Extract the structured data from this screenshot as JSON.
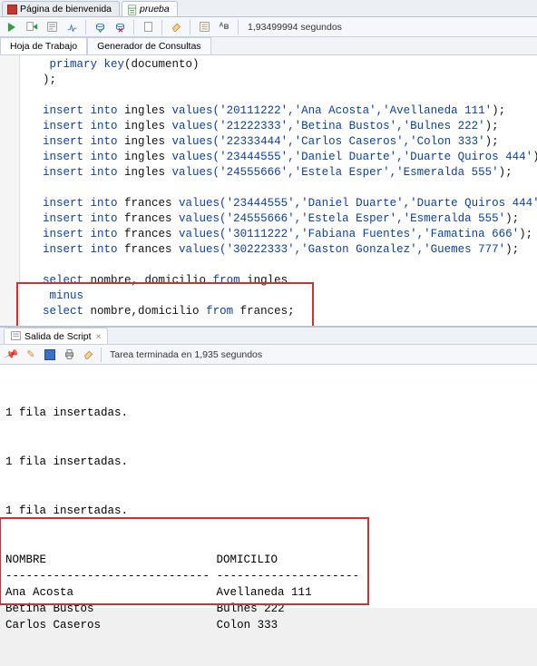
{
  "tabs": {
    "welcome": "Página de bienvenida",
    "file": "prueba"
  },
  "timer": "1,93499994 segundos",
  "subtabs": {
    "worksheet": "Hoja de Trabajo",
    "querybuilder": "Generador de Consultas"
  },
  "code": {
    "l1_a": "primary key",
    "l1_b": "(documento)",
    "l2": ");",
    "ins": "insert into",
    "vals": " values(",
    "t_ing": " ingles",
    "t_fra": " frances",
    "r1": "'20111222','Ana Acosta','Avellaneda 111'",
    "r2": "'21222333','Betina Bustos','Bulnes 222'",
    "r3": "'22333444','Carlos Caseros','Colon 333'",
    "r4": "'23444555','Daniel Duarte','Duarte Quiros 444'",
    "r5": "'24555666','Estela Esper','Esmeralda 555'",
    "f1": "'23444555','Daniel Duarte','Duarte Quiros 444'",
    "f2": "'24555666','Estela Esper','Esmeralda 555'",
    "f3": "'30111222','Fabiana Fuentes','Famatina 666'",
    "f4": "'30222333','Gaston Gonzalez','Guemes 777'",
    "end": ");",
    "sel": "select",
    "from": "from",
    "sel1_cols": " nombre, domicilio ",
    "sel1_tbl": " ingles",
    "minus": "minus",
    "sel2_cols": " nombre,domicilio ",
    "sel2_tbl": " frances"
  },
  "output": {
    "tab_title": "Salida de Script",
    "status": "Tarea terminada en 1,935 segundos",
    "row_inserted": "1 fila insertadas.",
    "hdr_nombre": "NOMBRE",
    "hdr_domicilio": "DOMICILIO",
    "dashes1": "------------------------------",
    "dashes2": "---------------------",
    "rows": [
      {
        "n": "Ana Acosta",
        "d": "Avellaneda 111"
      },
      {
        "n": "Betina Bustos",
        "d": "Bulnes 222"
      },
      {
        "n": "Carlos Caseros",
        "d": "Colon 333"
      }
    ]
  }
}
